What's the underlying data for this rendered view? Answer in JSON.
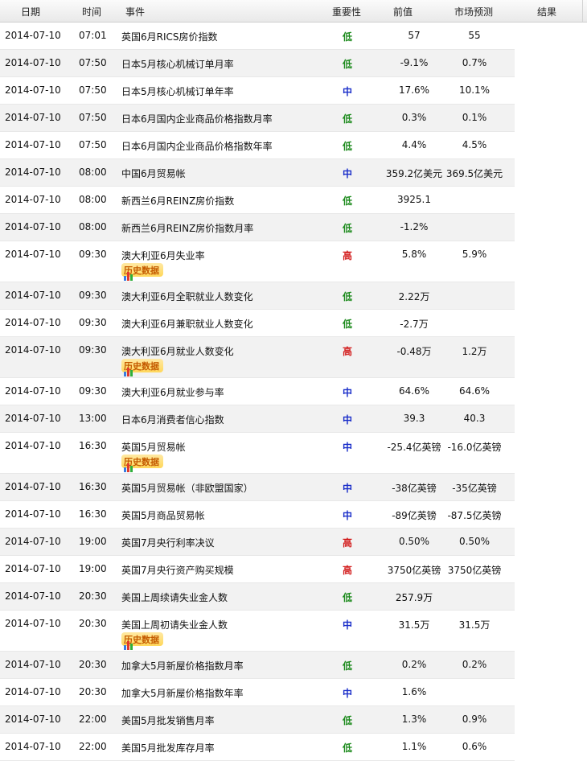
{
  "header": {
    "date": "日期",
    "time": "时间",
    "event": "事件",
    "importance": "重要性",
    "previous": "前值",
    "forecast": "市场预测",
    "result": "结果"
  },
  "history_label": "历史数据",
  "colors": {
    "low": "#1e8b1e",
    "mid": "#1a2ec9",
    "high": "#d21a1a"
  },
  "rows": [
    {
      "date": "2014-07-10",
      "time": "07:01",
      "event": "英国6月RICS房价指数",
      "importance": "低",
      "previous": "57",
      "forecast": "55",
      "history": false
    },
    {
      "date": "2014-07-10",
      "time": "07:50",
      "event": "日本5月核心机械订单月率",
      "importance": "低",
      "previous": "-9.1%",
      "forecast": "0.7%",
      "history": false
    },
    {
      "date": "2014-07-10",
      "time": "07:50",
      "event": "日本5月核心机械订单年率",
      "importance": "中",
      "previous": "17.6%",
      "forecast": "10.1%",
      "history": false
    },
    {
      "date": "2014-07-10",
      "time": "07:50",
      "event": "日本6月国内企业商品价格指数月率",
      "importance": "低",
      "previous": "0.3%",
      "forecast": "0.1%",
      "history": false
    },
    {
      "date": "2014-07-10",
      "time": "07:50",
      "event": "日本6月国内企业商品价格指数年率",
      "importance": "低",
      "previous": "4.4%",
      "forecast": "4.5%",
      "history": false
    },
    {
      "date": "2014-07-10",
      "time": "08:00",
      "event": "中国6月贸易帐",
      "importance": "中",
      "previous": "359.2亿美元",
      "forecast": "369.5亿美元",
      "history": false
    },
    {
      "date": "2014-07-10",
      "time": "08:00",
      "event": "新西兰6月REINZ房价指数",
      "importance": "低",
      "previous": "3925.1",
      "forecast": "",
      "history": false
    },
    {
      "date": "2014-07-10",
      "time": "08:00",
      "event": "新西兰6月REINZ房价指数月率",
      "importance": "低",
      "previous": "-1.2%",
      "forecast": "",
      "history": false
    },
    {
      "date": "2014-07-10",
      "time": "09:30",
      "event": "澳大利亚6月失业率",
      "importance": "高",
      "previous": "5.8%",
      "forecast": "5.9%",
      "history": true
    },
    {
      "date": "2014-07-10",
      "time": "09:30",
      "event": "澳大利亚6月全职就业人数变化",
      "importance": "低",
      "previous": "2.22万",
      "forecast": "",
      "history": false
    },
    {
      "date": "2014-07-10",
      "time": "09:30",
      "event": "澳大利亚6月兼职就业人数变化",
      "importance": "低",
      "previous": "-2.7万",
      "forecast": "",
      "history": false
    },
    {
      "date": "2014-07-10",
      "time": "09:30",
      "event": "澳大利亚6月就业人数变化",
      "importance": "高",
      "previous": "-0.48万",
      "forecast": "1.2万",
      "history": true
    },
    {
      "date": "2014-07-10",
      "time": "09:30",
      "event": "澳大利亚6月就业参与率",
      "importance": "中",
      "previous": "64.6%",
      "forecast": "64.6%",
      "history": false
    },
    {
      "date": "2014-07-10",
      "time": "13:00",
      "event": "日本6月消费者信心指数",
      "importance": "中",
      "previous": "39.3",
      "forecast": "40.3",
      "history": false
    },
    {
      "date": "2014-07-10",
      "time": "16:30",
      "event": "英国5月贸易帐",
      "importance": "中",
      "previous": "-25.4亿英镑",
      "forecast": "-16.0亿英镑",
      "history": true
    },
    {
      "date": "2014-07-10",
      "time": "16:30",
      "event": "英国5月贸易帐（非欧盟国家）",
      "importance": "中",
      "previous": "-38亿英镑",
      "forecast": "-35亿英镑",
      "history": false
    },
    {
      "date": "2014-07-10",
      "time": "16:30",
      "event": "英国5月商品贸易帐",
      "importance": "中",
      "previous": "-89亿英镑",
      "forecast": "-87.5亿英镑",
      "history": false
    },
    {
      "date": "2014-07-10",
      "time": "19:00",
      "event": "英国7月央行利率决议",
      "importance": "高",
      "previous": "0.50%",
      "forecast": "0.50%",
      "history": false
    },
    {
      "date": "2014-07-10",
      "time": "19:00",
      "event": "英国7月央行资产购买规模",
      "importance": "高",
      "previous": "3750亿英镑",
      "forecast": "3750亿英镑",
      "history": false
    },
    {
      "date": "2014-07-10",
      "time": "20:30",
      "event": "美国上周续请失业金人数",
      "importance": "低",
      "previous": "257.9万",
      "forecast": "",
      "history": false
    },
    {
      "date": "2014-07-10",
      "time": "20:30",
      "event": "美国上周初请失业金人数",
      "importance": "中",
      "previous": "31.5万",
      "forecast": "31.5万",
      "history": true
    },
    {
      "date": "2014-07-10",
      "time": "20:30",
      "event": "加拿大5月新屋价格指数月率",
      "importance": "低",
      "previous": "0.2%",
      "forecast": "0.2%",
      "history": false
    },
    {
      "date": "2014-07-10",
      "time": "20:30",
      "event": "加拿大5月新屋价格指数年率",
      "importance": "中",
      "previous": "1.6%",
      "forecast": "",
      "history": false
    },
    {
      "date": "2014-07-10",
      "time": "22:00",
      "event": "美国5月批发销售月率",
      "importance": "低",
      "previous": "1.3%",
      "forecast": "0.9%",
      "history": false
    },
    {
      "date": "2014-07-10",
      "time": "22:00",
      "event": "美国5月批发库存月率",
      "importance": "低",
      "previous": "1.1%",
      "forecast": "0.6%",
      "history": false
    }
  ]
}
